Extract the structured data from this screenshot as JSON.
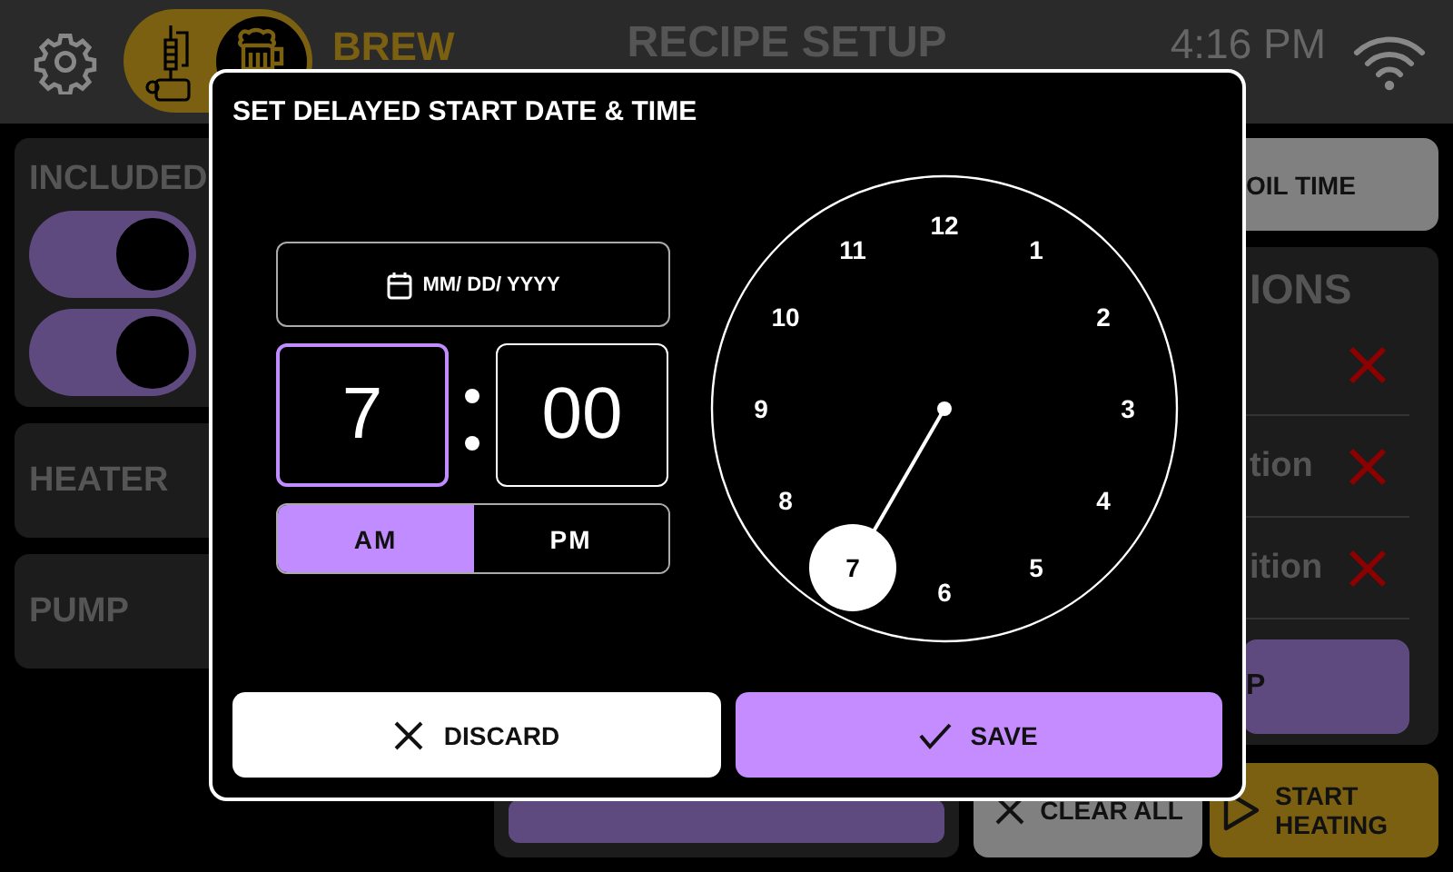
{
  "header": {
    "mode_switch": {
      "on": true
    },
    "mode_label": "BREW",
    "title": "RECIPE SETUP",
    "time": "4:16 PM"
  },
  "left_panel": {
    "included": {
      "title": "INCLUDED",
      "toggles": [
        {
          "on": true
        },
        {
          "on": true
        }
      ]
    },
    "sections": [
      {
        "title": "HEATER"
      },
      {
        "title": "PUMP"
      }
    ]
  },
  "right_panel": {
    "top_button": "OIL TIME",
    "list_title": "IONS",
    "rows": [
      {
        "removable": true
      },
      {
        "label": "tion",
        "removable": true
      },
      {
        "label": "ition",
        "removable": true
      }
    ],
    "action_button": "P"
  },
  "bottom_buttons": [
    {
      "kind": "clear",
      "label": "CLEAR ALL"
    },
    {
      "kind": "start",
      "label": "START HEATING"
    }
  ],
  "dialog": {
    "title": "SET DELAYED START DATE & TIME",
    "date": {
      "placeholder": "MM/ DD/ YYYY"
    },
    "hour": {
      "value": "7",
      "selected": true
    },
    "minute": {
      "value": "00",
      "selected": false
    },
    "meridiem": [
      {
        "label": "AM",
        "selected": true
      },
      {
        "label": "PM",
        "selected": false
      }
    ],
    "clock": {
      "numbers": [
        {
          "label": "12",
          "selected": false
        },
        {
          "label": "1",
          "selected": false
        },
        {
          "label": "2",
          "selected": false
        },
        {
          "label": "3",
          "selected": false
        },
        {
          "label": "4",
          "selected": false
        },
        {
          "label": "5",
          "selected": false
        },
        {
          "label": "6",
          "selected": false
        },
        {
          "label": "7",
          "selected": true
        },
        {
          "label": "8",
          "selected": false
        },
        {
          "label": "9",
          "selected": false
        },
        {
          "label": "10",
          "selected": false
        },
        {
          "label": "11",
          "selected": false
        }
      ]
    },
    "buttons": [
      {
        "kind": "discard",
        "label": "DISCARD"
      },
      {
        "kind": "save",
        "label": "SAVE"
      }
    ]
  }
}
